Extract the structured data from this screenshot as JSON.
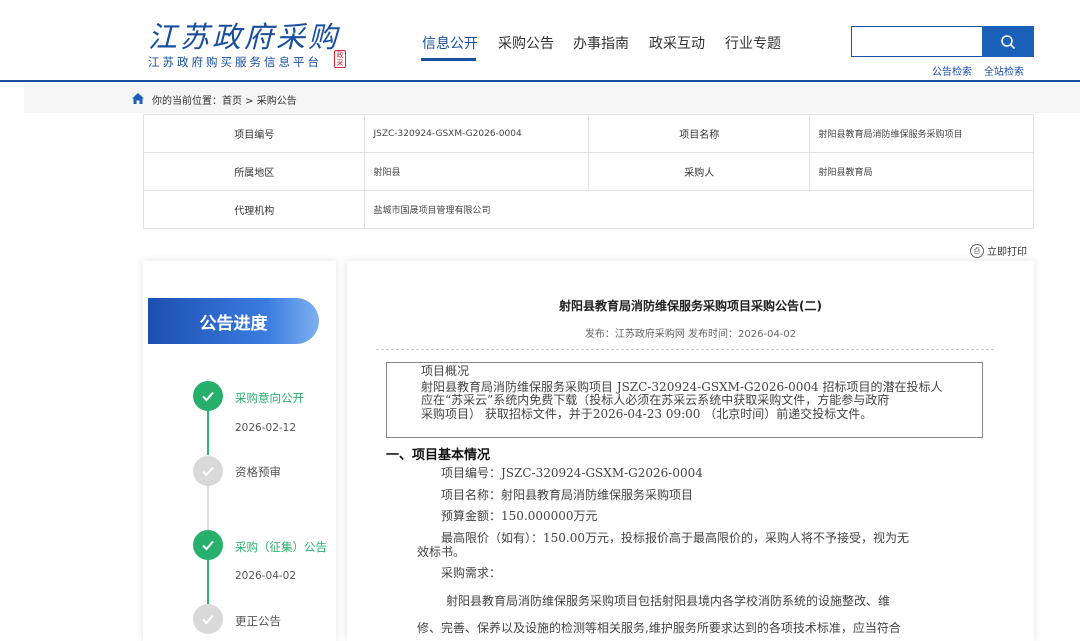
{
  "header": {
    "logo_title": "江苏政府采购",
    "logo_subtitle": "江苏政府购买服务信息平台",
    "logo_seal": "政采",
    "nav": [
      "信息公开",
      "采购公告",
      "办事指南",
      "政采互动",
      "行业专题"
    ],
    "active_nav": "信息公开",
    "search": {
      "placeholder": "",
      "button_icon": "search-icon"
    },
    "quick_links": [
      "公告检索",
      "全站检索"
    ]
  },
  "breadcrumb": {
    "prefix": "你的当前位置：",
    "items": [
      "首页",
      "采购公告"
    ],
    "text": "你的当前位置：首页 > 采购公告"
  },
  "info_table": {
    "rows": [
      [
        {
          "label": "项目编号",
          "value": "JSZC-320924-GSXM-G2026-0004"
        },
        {
          "label": "项目名称",
          "value": "射阳县教育局消防维保服务采购项目"
        }
      ],
      [
        {
          "label": "所属地区",
          "value": "射阳县"
        },
        {
          "label": "采购人",
          "value": "射阳县教育局"
        }
      ],
      [
        {
          "label": "代理机构",
          "value": "盐城市国晟项目管理有限公司"
        }
      ]
    ]
  },
  "print_label": "立即打印",
  "progress": {
    "title": "公告进度",
    "steps": [
      {
        "label": "采购意向公开",
        "date": "2026-02-12",
        "status": "done"
      },
      {
        "label": "资格预审",
        "date": "",
        "status": "todo"
      },
      {
        "label": "采购（征集）公告",
        "date": "2026-04-02",
        "status": "done"
      },
      {
        "label": "更正公告",
        "date": "",
        "status": "todo"
      }
    ]
  },
  "article": {
    "title": "射阳县教育局消防维保服务采购项目采购公告(二)",
    "meta": "发布：江苏政府采购网   发布时间：2026-04-02",
    "overview_title": "项目概况",
    "overview_lines": [
      "射阳县教育局消防维保服务采购项目 JSZC-320924-GSXM-G2026-0004 招标项目的潜在投标人",
      "应在“苏采云”系统内免费下载（投标人必须在苏采云系统中获取采购文件，方能参与政府",
      "采购项目） 获取招标文件，并于2026-04-23 09:00 （北京时间）前递交投标文件。"
    ],
    "section1_title": "一、项目基本情况",
    "fields": [
      "项目编号：JSZC-320924-GSXM-G2026-0004",
      "项目名称：射阳县教育局消防维保服务采购项目",
      "预算金额：150.000000万元"
    ],
    "max_price_line1": "最高限价（如有）：150.00万元，投标报价高于最高限价的，采购人将不予接受，视为无",
    "max_price_line2": "效标书。",
    "demand_label": "采购需求：",
    "demand_line1": "射阳县教育局消防维保服务采购项目包括射阳县境内各学校消防系统的设施整改、维",
    "demand_line2": "修、完善、保养以及设施的检测等相关服务,维护服务所要求达到的各项技术标准，应当符合"
  },
  "colors": {
    "brand_blue": "#1a4fa0",
    "done_green": "#27b06b",
    "todo_gray": "#d9d9d9"
  }
}
